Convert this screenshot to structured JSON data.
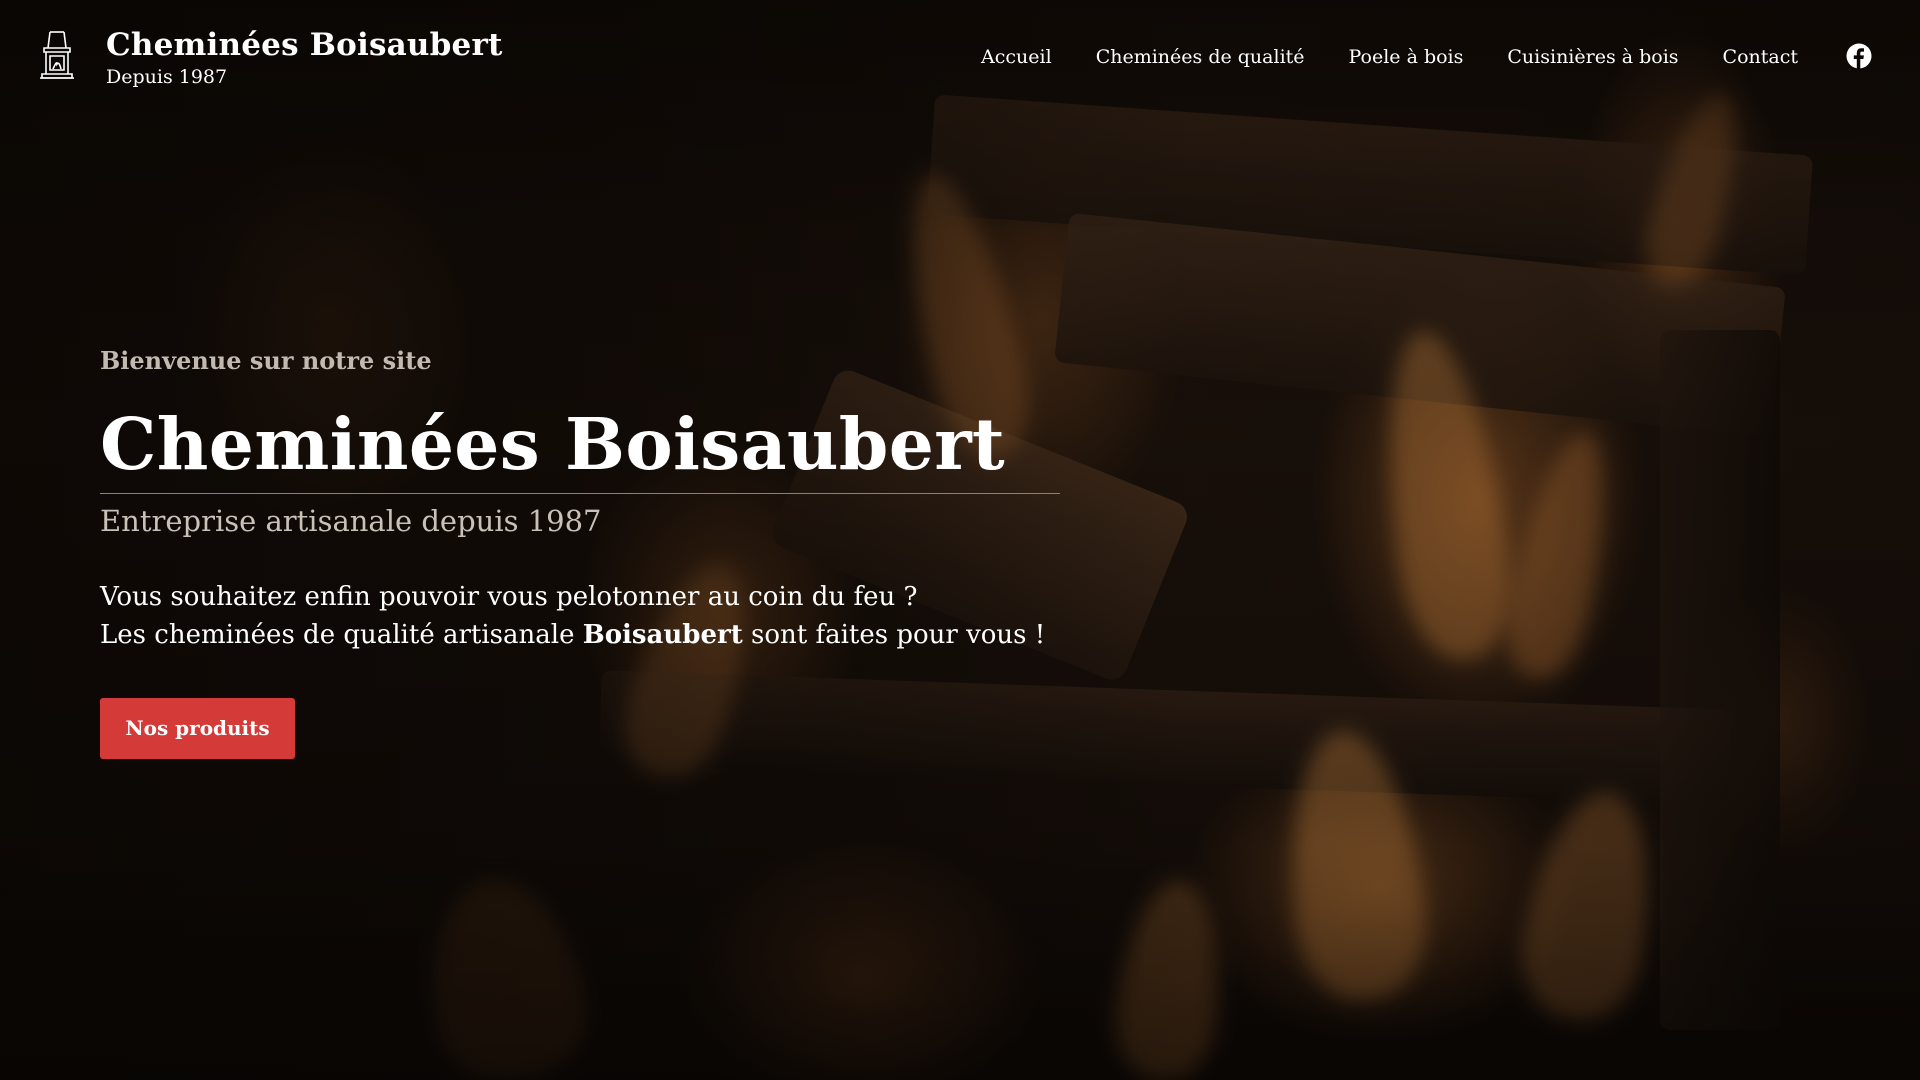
{
  "brand": {
    "name": "Cheminées Boisaubert",
    "tagline": "Depuis 1987",
    "logo_icon": "fireplace-logo-icon"
  },
  "nav": {
    "items": [
      {
        "label": "Accueil"
      },
      {
        "label": "Cheminées de qualité"
      },
      {
        "label": "Poele à bois"
      },
      {
        "label": "Cuisinières à bois"
      },
      {
        "label": "Contact"
      }
    ],
    "social_icon": "facebook-icon"
  },
  "hero": {
    "kicker": "Bienvenue sur notre site",
    "title": "Cheminées Boisaubert",
    "subtitle": "Entreprise artisanale depuis 1987",
    "body_line1": "Vous souhaitez enfin pouvoir vous pelotonner au coin du feu ?",
    "body_line2_before": "Les cheminées de qualité artisanale ",
    "body_line2_bold": "Boisaubert",
    "body_line2_after": " sont faites pour vous !",
    "cta_label": "Nos produits"
  },
  "colors": {
    "cta_background": "#d43b38",
    "text": "#ffffff",
    "muted_text": "#c9c1b8",
    "page_background": "#0b0705"
  }
}
